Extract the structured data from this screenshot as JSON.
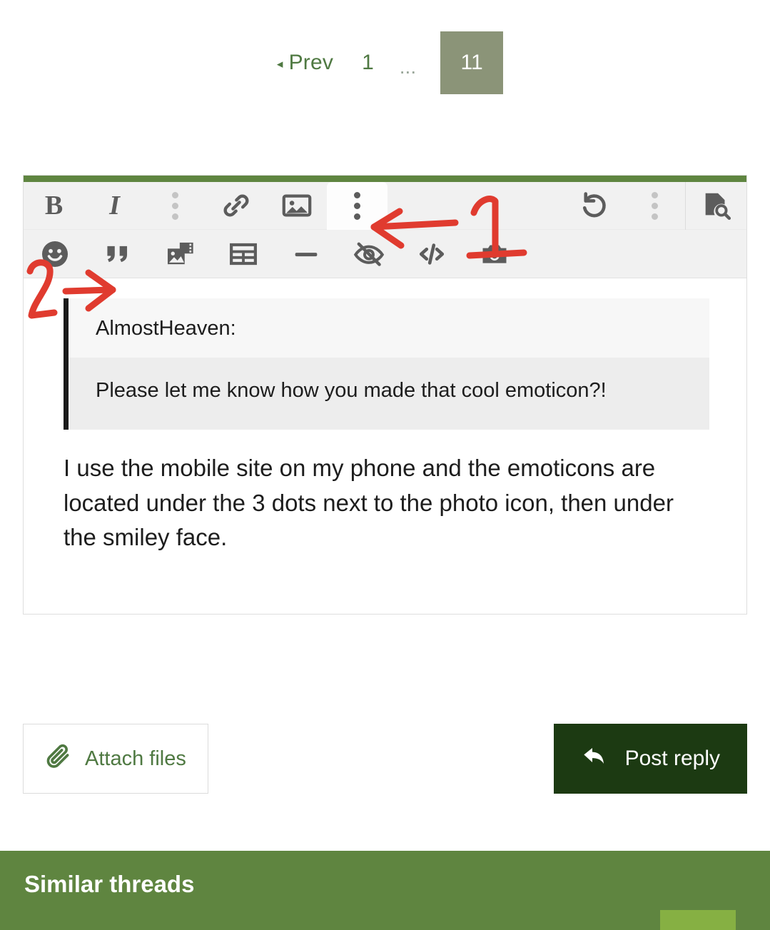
{
  "pagination": {
    "prev_label": "Prev",
    "prev_caret": "◂",
    "first_page": "1",
    "ellipsis": "...",
    "current_page": "11"
  },
  "editor": {
    "accent_color": "#5f8540",
    "toolbar": {
      "row1": [
        {
          "name": "bold-button",
          "label": "B",
          "kind": "text-bold",
          "state": "enabled"
        },
        {
          "name": "italic-button",
          "label": "I",
          "kind": "text-italic",
          "state": "enabled"
        },
        {
          "name": "more-text-options-icon",
          "label": "",
          "kind": "vertical-dots",
          "state": "disabled"
        },
        {
          "name": "insert-link-button",
          "label": "",
          "kind": "link",
          "state": "enabled"
        },
        {
          "name": "insert-image-button",
          "label": "",
          "kind": "image",
          "state": "enabled"
        },
        {
          "name": "more-options-button",
          "label": "",
          "kind": "vertical-dots",
          "state": "active"
        },
        {
          "name": "undo-button",
          "label": "",
          "kind": "undo",
          "state": "enabled"
        },
        {
          "name": "more-history-options-icon",
          "label": "",
          "kind": "vertical-dots",
          "state": "disabled"
        },
        {
          "name": "preview-button",
          "label": "",
          "kind": "document-search",
          "state": "enabled"
        }
      ],
      "row2": [
        {
          "name": "smilies-button",
          "label": "",
          "kind": "smiley",
          "state": "enabled"
        },
        {
          "name": "quote-button",
          "label": "",
          "kind": "quote",
          "state": "enabled"
        },
        {
          "name": "insert-gallery-button",
          "label": "",
          "kind": "media-gallery",
          "state": "enabled"
        },
        {
          "name": "insert-table-button",
          "label": "",
          "kind": "table",
          "state": "enabled"
        },
        {
          "name": "horizontal-rule-button",
          "label": "",
          "kind": "horizontal-rule",
          "state": "enabled"
        },
        {
          "name": "spoiler-button",
          "label": "",
          "kind": "eye-slash",
          "state": "enabled"
        },
        {
          "name": "code-button",
          "label": "",
          "kind": "code",
          "state": "enabled"
        },
        {
          "name": "camera-button",
          "label": "",
          "kind": "camera",
          "state": "enabled"
        }
      ]
    },
    "quote": {
      "author": "AlmostHeaven:",
      "text": "Please let me know how you made that cool emoticon?!"
    },
    "reply_text": "I use the mobile site on my phone and the emoticons are located under the 3 dots next to the photo icon, then under the smiley face."
  },
  "actions": {
    "attach_label": "Attach files",
    "post_label": "Post reply"
  },
  "similar_threads": {
    "title": "Similar threads"
  },
  "annotations": {
    "marker_one": "1",
    "marker_two": "2",
    "color": "#e03b2f"
  }
}
